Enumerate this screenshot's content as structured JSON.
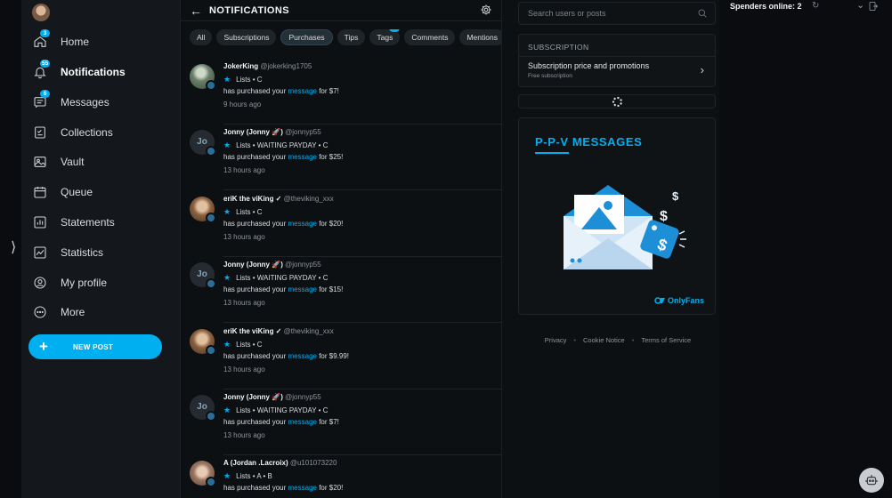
{
  "sidebar": {
    "items": [
      {
        "label": "Home",
        "badge": "3",
        "icon": "home-icon"
      },
      {
        "label": "Notifications",
        "badge": "55",
        "icon": "bell-icon"
      },
      {
        "label": "Messages",
        "badge": "6",
        "icon": "messages-icon"
      },
      {
        "label": "Collections",
        "badge": "",
        "icon": "collections-icon"
      },
      {
        "label": "Vault",
        "badge": "",
        "icon": "vault-icon"
      },
      {
        "label": "Queue",
        "badge": "",
        "icon": "calendar-icon"
      },
      {
        "label": "Statements",
        "badge": "",
        "icon": "statements-icon"
      },
      {
        "label": "Statistics",
        "badge": "",
        "icon": "statistics-icon"
      },
      {
        "label": "My profile",
        "badge": "",
        "icon": "profile-icon"
      },
      {
        "label": "More",
        "badge": "",
        "icon": "more-icon"
      }
    ],
    "new_post_label": "NEW POST"
  },
  "header": {
    "title": "NOTIFICATIONS"
  },
  "tabs": [
    {
      "label": "All",
      "badge": ""
    },
    {
      "label": "Subscriptions",
      "badge": ""
    },
    {
      "label": "Purchases",
      "badge": ""
    },
    {
      "label": "Tips",
      "badge": ""
    },
    {
      "label": "Tags",
      "badge": "55"
    },
    {
      "label": "Comments",
      "badge": ""
    },
    {
      "label": "Mentions",
      "badge": ""
    }
  ],
  "active_tab": "Purchases",
  "notifications": [
    {
      "display": "JokerKing",
      "handle": "@jokerking1705",
      "lists": "Lists • C",
      "prefix": "has purchased your ",
      "link": "message",
      "suffix": " for $7!",
      "time": "9 hours ago",
      "avatar": "photo1",
      "initials": ""
    },
    {
      "display": "Jonny (Jonny 🚀)",
      "handle": "@jonnyp55",
      "lists": "Lists • WAITING PAYDAY • C",
      "prefix": "has purchased your ",
      "link": "message",
      "suffix": " for $25!",
      "time": "13 hours ago",
      "avatar": "initials",
      "initials": "Jo"
    },
    {
      "display": "eriK the viKing ✓",
      "handle": "@theviking_xxx",
      "lists": "Lists • C",
      "prefix": "has purchased your ",
      "link": "message",
      "suffix": " for $20!",
      "time": "13 hours ago",
      "avatar": "photo2",
      "initials": ""
    },
    {
      "display": "Jonny (Jonny 🚀)",
      "handle": "@jonnyp55",
      "lists": "Lists • WAITING PAYDAY • C",
      "prefix": "has purchased your ",
      "link": "message",
      "suffix": " for $15!",
      "time": "13 hours ago",
      "avatar": "initials",
      "initials": "Jo"
    },
    {
      "display": "eriK the viKing ✓",
      "handle": "@theviking_xxx",
      "lists": "Lists • C",
      "prefix": "has purchased your ",
      "link": "message",
      "suffix": " for $9.99!",
      "time": "13 hours ago",
      "avatar": "photo2",
      "initials": ""
    },
    {
      "display": "Jonny (Jonny 🚀)",
      "handle": "@jonnyp55",
      "lists": "Lists • WAITING PAYDAY • C",
      "prefix": "has purchased your ",
      "link": "message",
      "suffix": " for $7!",
      "time": "13 hours ago",
      "avatar": "initials",
      "initials": "Jo"
    },
    {
      "display": "A (Jordan .Lacroix)",
      "handle": "@u101073220",
      "lists": "Lists • A • B",
      "prefix": "has purchased your ",
      "link": "message",
      "suffix": " for $20!",
      "time": "",
      "avatar": "photo3",
      "initials": ""
    }
  ],
  "search": {
    "placeholder": "Search users or posts"
  },
  "subscription": {
    "title": "SUBSCRIPTION",
    "main": "Subscription price and promotions",
    "sub": "Free subscription"
  },
  "promo": {
    "title": "P-P-V  MESSAGES",
    "brand": "OnlyFans"
  },
  "footer": {
    "privacy": "Privacy",
    "cookie": "Cookie Notice",
    "terms": "Terms of Service"
  },
  "spenders": {
    "label": "Spenders online: 2"
  },
  "colors": {
    "accent": "#00aff0",
    "background": "#0d1013",
    "sidebar": "#14171b"
  }
}
